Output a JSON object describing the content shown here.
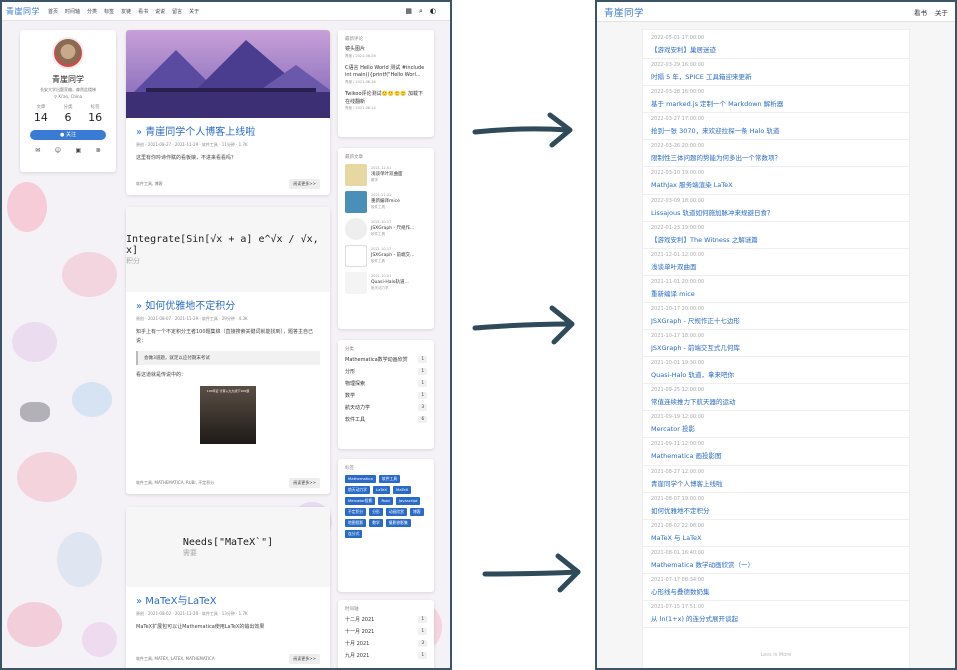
{
  "blog": {
    "brand": "青崖同学",
    "nav": [
      "首页",
      "时间轴",
      "分类",
      "标签",
      "友链",
      "看书",
      "说说",
      "留言",
      "关于"
    ],
    "profile": {
      "name": "青崖同学",
      "bio": "长安大学出题家编，森然此楼梯",
      "location": "Xi'an, China",
      "stats": [
        {
          "label": "文章",
          "value": "14"
        },
        {
          "label": "分类",
          "value": "6"
        },
        {
          "label": "标签",
          "value": "16"
        }
      ],
      "follow": "关注"
    },
    "posts": [
      {
        "title": "青崖同学个人博客上线啦",
        "meta": "原创 · 2021-08-27 · 2021-11-29 · 软件工具 · 11分钟 · 1.7K",
        "excerpt": "这里有你吟诗作赋的看板娘，不进来看看吗？",
        "tags": "软件工具, 博客",
        "more": "阅读更多>>"
      },
      {
        "title": "如何优雅地不定积分",
        "formula": "Integrate[Sin[√x + a] e^√x / √x, x]",
        "formula_sub": "积分",
        "meta": "原创 · 2021-08-07 · 2021-11-29 · 软件工具 · 29分钟 · 4.3K",
        "excerpt": "知乎上有一个不定积分王者100题集锦（直接搜索关键词就能找到），题答主自己说：",
        "quote": "会做3道题，就足以应付期末考试",
        "excerpt2": "看这道就是传说中的：",
        "pic_caption": "100年证 计算入九九线下100题",
        "tags": "软件工具, MATHEMATICA, RUBI, 不定积分",
        "more": "阅读更多>>"
      },
      {
        "title": "MaTeX与LaTeX",
        "formula": "Needs[\"MaTeX`\"]",
        "formula_sub": "需要",
        "meta": "原创 · 2021-08-02 · 2021-11-29 · 软件工具 · 13分钟 · 1.7K",
        "excerpt": "MaTeX扩展包可以让Mathematica使用LaTeX的输出效果",
        "tags": "软件工具, MATEX, LATEX, MATHEMATICA",
        "more": "阅读更多>>"
      }
    ],
    "side_comments": {
      "title": "最新评论",
      "items": [
        {
          "text": "镜头图片",
          "sub": "青崖 / 2021-08-26"
        },
        {
          "text": "C语言 Hello World 测试 #include int main(){printf(\"Hello Worl...",
          "sub": "青崖 / 2021-08-26"
        },
        {
          "text": "Twikoo评论测试🙂🙂🙂🙂 加载下在线翻新",
          "sub": "青崖 / 2021-08-24"
        }
      ]
    },
    "side_recent": {
      "title": "最新文章",
      "items": [
        {
          "date": "2021-12-01",
          "text": "浅谈单叶双曲面",
          "sub": "数学"
        },
        {
          "date": "2021-11-01",
          "text": "重新编译mice",
          "sub": "软件工具"
        },
        {
          "date": "2021-10-17",
          "text": "JSXGraph - 尺规作...",
          "sub": "软件工具"
        },
        {
          "date": "2021-10-17",
          "text": "JSXGraph - 前端交...",
          "sub": "软件工具"
        },
        {
          "date": "2021-10-01",
          "text": "Quasi-Halo轨道...",
          "sub": "航天动力学"
        }
      ]
    },
    "side_categories": {
      "title": "分类",
      "items": [
        {
          "name": "Mathematica数学动画欣赏",
          "count": "1"
        },
        {
          "name": "分形",
          "count": "1"
        },
        {
          "name": "物理探索",
          "count": "1"
        },
        {
          "name": "数学",
          "count": "1"
        },
        {
          "name": "航天动力学",
          "count": "3"
        },
        {
          "name": "软件工具",
          "count": "6"
        }
      ]
    },
    "side_tags": {
      "title": "标签",
      "items": [
        "Mathematica",
        "软件工具",
        "航天动力学",
        "LaTeX",
        "MaTeX",
        "Mercator投影",
        "Rubi",
        "Javascript",
        "不定积分",
        "分形",
        "动画欣赏",
        "博客",
        "地图投影",
        "数学",
        "摄影修影集",
        "连分式"
      ]
    },
    "side_archive": {
      "title": "时间轴",
      "items": [
        {
          "name": "十二月 2021",
          "count": "1"
        },
        {
          "name": "十一月 2021",
          "count": "1"
        },
        {
          "name": "十月 2021",
          "count": "3"
        },
        {
          "name": "九月 2021",
          "count": "1"
        }
      ]
    }
  },
  "archive": {
    "brand": "青崖同学",
    "links": [
      "看书",
      "关于"
    ],
    "rows": [
      {
        "date": "2022-05-01 17:00:00",
        "title": "【游戏安利】巢居迷迹"
      },
      {
        "date": "2022-03-29 16:00:00",
        "title": "时隔 5 年，SPICE 工具箱迎来更新"
      },
      {
        "date": "2022-03-28 16:00:00",
        "title": "基于 marked.js 定制一个 Markdown 解析器"
      },
      {
        "date": "2022-03-27 17:00:00",
        "title": "抢到一张 3070，来欢迎拉探一条 Halo 轨道"
      },
      {
        "date": "2022-03-26 20:00:00",
        "title": "限制性三体问题的势能为何多出一个常数项？"
      },
      {
        "date": "2022-03-10 19:00:00",
        "title": "MathJax 服务端渲染 LaTeX"
      },
      {
        "date": "2022-03-09 18:00:00",
        "title": "Lissajous 轨道如何施加脉冲来规避日食？"
      },
      {
        "date": "2022-01-23 19:00:00",
        "title": "【游戏安利】The Witness 之解谜篇"
      },
      {
        "date": "2021-12-01 12:00:00",
        "title": "浅谈单叶双曲面"
      },
      {
        "date": "2021-11-01 20:00:00",
        "title": "重新编译 mice"
      },
      {
        "date": "2021-10-17 20:00:00",
        "title": "JSXGraph - 尺规作正十七边形"
      },
      {
        "date": "2021-10-17 18:00:00",
        "title": "JSXGraph - 前端交互式几何库"
      },
      {
        "date": "2021-10-01 19:30:00",
        "title": "Quasi-Halo 轨道，拿来吧你"
      },
      {
        "date": "2021-09-25 12:00:00",
        "title": "常值连续推力下航天器的运动"
      },
      {
        "date": "2021-09-19 12:00:00",
        "title": "Mercator 投影"
      },
      {
        "date": "2021-09-11 12:00:00",
        "title": "Mathematica 画投影图"
      },
      {
        "date": "2021-08-27 12:00:00",
        "title": "青崖同学个人博客上线啦"
      },
      {
        "date": "2021-08-07 19:00:00",
        "title": "如何优雅地不定积分"
      },
      {
        "date": "2021-08-02 22:08:00",
        "title": "MaTeX 与 LaTeX"
      },
      {
        "date": "2021-08-01 16:40:00",
        "title": "Mathematica 数学动画欣赏（一）"
      },
      {
        "date": "2021-07-17 08:34:00",
        "title": "心形线与叠德数奶集"
      },
      {
        "date": "2021-07-15 17:51:00",
        "title": "从 ln(1+x) 的连分式展开谈起"
      }
    ],
    "less_more": "Less is More"
  },
  "colors": {
    "accent": "#2a6bc7",
    "frame": "#3b5566",
    "arrow": "#2f4a59"
  }
}
